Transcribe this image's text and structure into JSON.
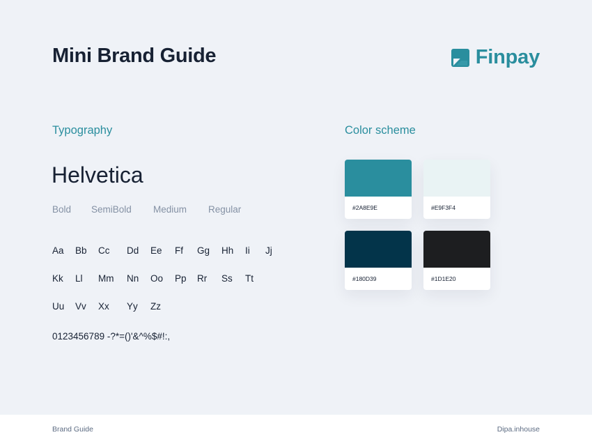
{
  "header": {
    "title": "Mini Brand Guide",
    "brand_name": "Finpay",
    "brand_icon": "finpay-logo-icon"
  },
  "typography": {
    "section_title": "Typography",
    "font_name": "Helvetica",
    "weights": [
      "Bold",
      "SemiBold",
      "Medium",
      "Regular"
    ],
    "glyph_rows": [
      [
        "Aa",
        "Bb",
        "Cc",
        "Dd",
        "Ee",
        "Ff",
        "Gg",
        "Hh",
        "Ii",
        "Jj"
      ],
      [
        "Kk",
        "Ll",
        "Mm",
        "Nn",
        "Oo",
        "Pp",
        "Rr",
        "Ss",
        "Tt"
      ],
      [
        "Uu",
        "Vv",
        "Xx",
        "Yy",
        "Zz"
      ]
    ],
    "digits": "0123456789 -?*=()'&^%$#!:,"
  },
  "colors": {
    "section_title": "Color scheme",
    "swatches": [
      {
        "label": "#2A8E9E",
        "color": "#2A8E9E"
      },
      {
        "label": "#E9F3F4",
        "color": "#E9F3F4"
      },
      {
        "label": "#180D39",
        "color": "#03344A"
      },
      {
        "label": "#1D1E20",
        "color": "#1D1E20"
      }
    ]
  },
  "footer": {
    "left": "Brand Guide",
    "right": "Dipa.inhouse"
  }
}
